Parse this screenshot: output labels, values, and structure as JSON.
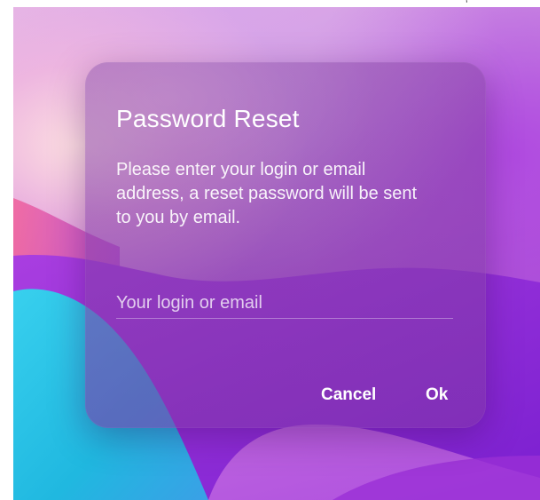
{
  "dialog": {
    "title": "Password Reset",
    "message": "Please enter your login or email address, a reset password will be sent to you by email.",
    "login_field": {
      "placeholder": "Your login or email",
      "value": ""
    },
    "buttons": {
      "cancel": "Cancel",
      "ok": "Ok"
    }
  },
  "colors": {
    "wallpaper_pink": "#f3c7d8",
    "wallpaper_purple": "#a246d2",
    "wallpaper_cyan": "#2ec3e6",
    "dialog_tint": "#8c46aa",
    "text": "#ffffff"
  },
  "glyphs": {
    "corner_mark": "ʼ"
  }
}
